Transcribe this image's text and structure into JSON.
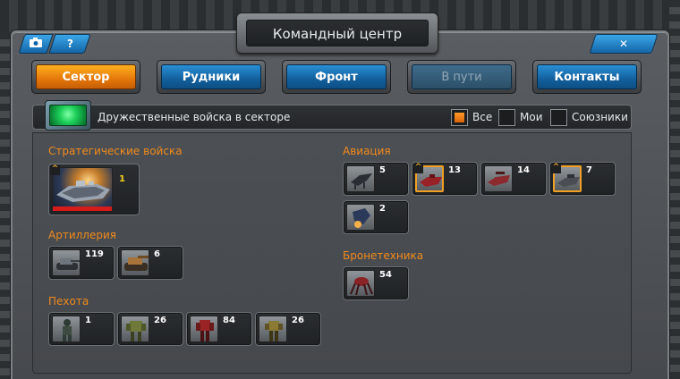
{
  "header": {
    "title": "Командный центр",
    "help_label": "?",
    "close_label": "✕",
    "camera_icon": "camera-icon"
  },
  "tabs": [
    {
      "label": "Сектор",
      "state": "active"
    },
    {
      "label": "Рудники",
      "state": "normal"
    },
    {
      "label": "Фронт",
      "state": "normal"
    },
    {
      "label": "В пути",
      "state": "disabled"
    },
    {
      "label": "Контакты",
      "state": "normal"
    }
  ],
  "filter": {
    "label": "Дружественные войска в секторе",
    "options": [
      {
        "label": "Все",
        "checked": true
      },
      {
        "label": "Мои",
        "checked": false
      },
      {
        "label": "Союзники",
        "checked": false
      }
    ]
  },
  "sections": {
    "strategic": {
      "title": "Стратегические войска",
      "units": [
        {
          "count": "1",
          "icon": "battleship-icon",
          "elite": true
        }
      ]
    },
    "artillery": {
      "title": "Артиллерия",
      "units": [
        {
          "count": "119",
          "icon": "tank-icon"
        },
        {
          "count": "6",
          "icon": "artillery-vehicle-icon"
        }
      ]
    },
    "infantry": {
      "title": "Пехота",
      "units": [
        {
          "count": "1",
          "icon": "soldier-icon"
        },
        {
          "count": "26",
          "icon": "mech-icon"
        },
        {
          "count": "84",
          "icon": "red-mech-icon"
        },
        {
          "count": "26",
          "icon": "exoskeleton-icon"
        }
      ]
    },
    "aviation": {
      "title": "Авиация",
      "units": [
        {
          "count": "5",
          "icon": "drone-icon"
        },
        {
          "count": "13",
          "icon": "red-fighter-icon",
          "elite": true
        },
        {
          "count": "14",
          "icon": "red-gunship-icon"
        },
        {
          "count": "7",
          "icon": "bomber-icon",
          "elite": true
        },
        {
          "count": "2",
          "icon": "jet-icon"
        }
      ]
    },
    "armor": {
      "title": "Бронетехника",
      "units": [
        {
          "count": "54",
          "icon": "spider-walker-icon"
        }
      ]
    }
  },
  "colors": {
    "accent_orange": "#f08a1c",
    "tab_blue": "#1466a6",
    "elite_gold": "#f1a024"
  }
}
